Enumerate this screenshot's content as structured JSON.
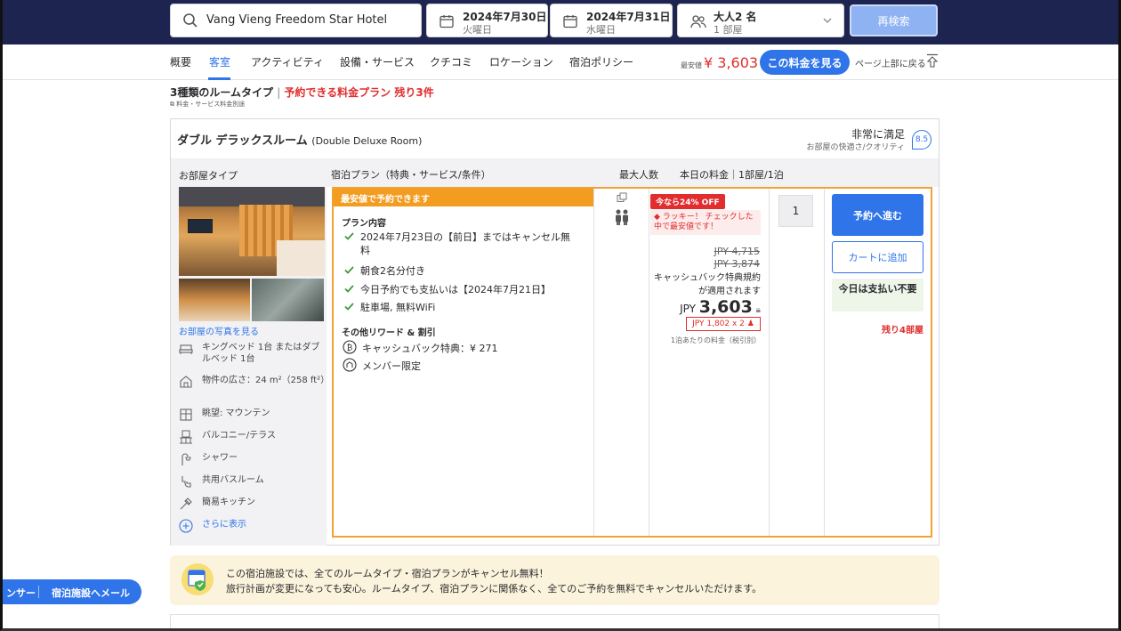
{
  "search": {
    "destination": "Vang Vieng Freedom Star Hotel",
    "checkin_date": "2024年7月30日",
    "checkin_day": "火曜日",
    "checkout_date": "2024年7月31日",
    "checkout_day": "水曜日",
    "guests": "大人2 名",
    "rooms": "1 部屋",
    "recheck_label": "再検索"
  },
  "nav": {
    "tabs": [
      "概要",
      "客室",
      "アクティビティ",
      "設備・サービス",
      "クチコミ",
      "ロケーション",
      "宿泊ポリシー"
    ],
    "active_tab": "客室",
    "lowest_label": "最安値",
    "lowest_price": "¥ 3,603",
    "see_price_button": "この料金を見る",
    "back_to_top": "ページ上部に戻る"
  },
  "rooms_header": {
    "title": "3種類のルームタイプ",
    "separator": "|",
    "highlight": "予約できる料金プラン 残り3件",
    "fee_note": "料金・サービス料金別途"
  },
  "room": {
    "name": "ダブル デラックスルーム",
    "name_en": "(Double Deluxe Room)",
    "rating_label": "非常に満足",
    "rating_sub": "お部屋の快適さ/クオリティ",
    "rating_score": "8.5",
    "columns": {
      "room_type": "お部屋タイプ",
      "plan": "宿泊プラン（特典・サービス/条件）",
      "max_guests": "最大人数",
      "price": "本日の料金｜1部屋/1泊"
    },
    "see_photos": "お部屋の写真を見る",
    "features": [
      {
        "icon": "bed-icon",
        "label": "キングベッド 1台 またはダブルベッド 1台"
      },
      {
        "icon": "house-icon",
        "label": "物件の広さ：24 m²（258 ft²）"
      },
      {
        "icon": "window-icon",
        "label": "眺望: マウンテン"
      },
      {
        "icon": "balcony-icon",
        "label": "バルコニー/テラス"
      },
      {
        "icon": "shower-icon",
        "label": "シャワー"
      },
      {
        "icon": "bath-icon",
        "label": "共用バスルーム"
      },
      {
        "icon": "kitchen-icon",
        "label": "簡易キッチン"
      }
    ],
    "show_more": "さらに表示"
  },
  "plan": {
    "banner": "最安値で予約できます",
    "content_title": "プラン内容",
    "items": [
      "2024年7月23日の【前日】まではキャンセル無料",
      "朝食2名分付き",
      "今日予約でも支払いは【2024年7月21日】",
      "駐車場, 無料WiFi"
    ],
    "rewards_title": "その他リワード & 割引",
    "rewards": [
      "キャッシュバック特典：¥ 271",
      "メンバー限定"
    ],
    "discount_badge": "今なら24% OFF",
    "lucky_text": "ラッキー！ チェックした中で最安値です！",
    "strike_price_1": "JPY 4,715",
    "strike_price_2": "JPY 3,874",
    "cashback_note": "キャッシュバック特典規約が適用されます",
    "currency": "JPY",
    "final_price": "3,603",
    "per_person": "JPY 1,802 x 2",
    "per_night": "1泊あたりの料金（税引別）",
    "quantity": "1",
    "book_button": "予約へ進む",
    "cart_button": "カートに追加",
    "pay_today": "今日は支払い不要",
    "rooms_left": "残り4部屋"
  },
  "notice": {
    "line1": "この宿泊施設では、全てのルームタイプ・宿泊プランがキャンセル無料！",
    "line2": "旅行計画が変更になっても安心。ルームタイプ、宿泊プランに関係なく、全てのご予約を無料でキャンセルいただけます。"
  },
  "float_bar": {
    "left_label": "ンサー",
    "right_label": "宿泊施設へメール"
  },
  "colors": {
    "accent": "#2f74e8",
    "header_bg": "#1e2450",
    "highlight_red": "#e12d2d",
    "plan_border": "#f2a233"
  }
}
